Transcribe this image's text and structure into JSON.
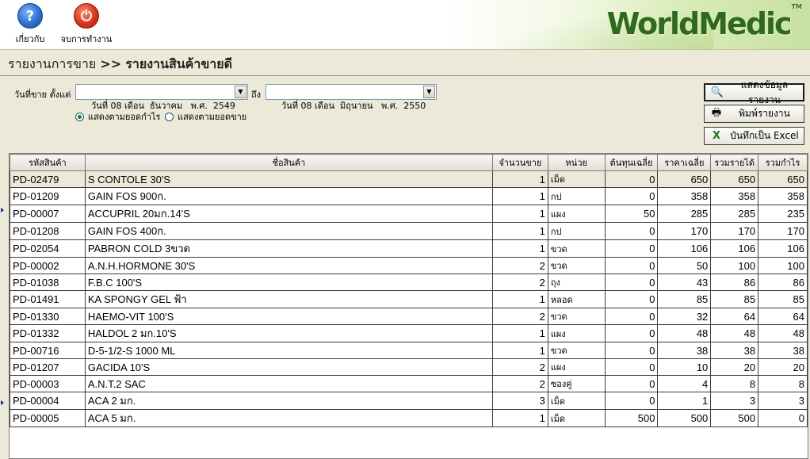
{
  "toolbar": {
    "about_label": "เกี่ยวกับ",
    "exit_label": "จบการทำงาน",
    "logo_text": "WorldMedic",
    "logo_tm": "TM"
  },
  "breadcrumb": {
    "section": "รายงานการขาย",
    "separator": ">>",
    "page": "รายงานสินค้าขายดี"
  },
  "filter": {
    "date_label": "วันที่ขาย  ตั้งแต่",
    "from_date": "วันที่ 08 เดือน  ธันวาคม   พ.ศ.  2549",
    "to_label": "ถึง",
    "to_date": "วันที่ 08 เดือน  มิถุนายน   พ.ศ.  2550",
    "radio_profit": "แสดงตามยอดกำไร",
    "radio_sales": "แสดงตามยอดขาย",
    "selected": "profit"
  },
  "buttons": {
    "show_report": "แสดงข้อมูลรายงาน",
    "print_report": "พิมพ์รายงาน",
    "save_excel": "บันทึกเป็น Excel"
  },
  "table": {
    "headers": [
      "รหัสสินค้า",
      "ชื่อสินค้า",
      "จำนวนขาย",
      "หน่วย",
      "ต้นทุนเฉลี่ย",
      "ราคาเฉลี่ย",
      "รวมรายได้",
      "รวมกำไร"
    ],
    "rows": [
      [
        "PD-02479",
        "S CONTOLE 30'S",
        "1",
        "เม็ด",
        "0",
        "650",
        "650",
        "650"
      ],
      [
        "PD-01209",
        "GAIN FOS 900ก.",
        "1",
        "กป",
        "0",
        "358",
        "358",
        "358"
      ],
      [
        "PD-00007",
        "ACCUPRIL 20มก.14'S",
        "1",
        "แผง",
        "50",
        "285",
        "285",
        "235"
      ],
      [
        "PD-01208",
        "GAIN FOS 400ก.",
        "1",
        "กป",
        "0",
        "170",
        "170",
        "170"
      ],
      [
        "PD-02054",
        "PABRON COLD 3ขวด",
        "1",
        "ขวด",
        "0",
        "106",
        "106",
        "106"
      ],
      [
        "PD-00002",
        "A.N.H.HORMONE 30'S",
        "2",
        "ขวด",
        "0",
        "50",
        "100",
        "100"
      ],
      [
        "PD-01038",
        "F.B.C 100'S",
        "2",
        "ถุง",
        "0",
        "43",
        "86",
        "86"
      ],
      [
        "PD-01491",
        "KA SPONGY GEL ฟ้า",
        "1",
        "หลอด",
        "0",
        "85",
        "85",
        "85"
      ],
      [
        "PD-01330",
        "HAEMO-VIT 100'S",
        "2",
        "ขวด",
        "0",
        "32",
        "64",
        "64"
      ],
      [
        "PD-01332",
        "HALDOL 2 มก.10'S",
        "1",
        "แผง",
        "0",
        "48",
        "48",
        "48"
      ],
      [
        "PD-00716",
        "D-5-1/2-S 1000 ML",
        "1",
        "ขวด",
        "0",
        "38",
        "38",
        "38"
      ],
      [
        "PD-01207",
        "GACIDA 10'S",
        "2",
        "แผง",
        "0",
        "10",
        "20",
        "20"
      ],
      [
        "PD-00003",
        "A.N.T.2 SAC",
        "2",
        "ซองคู่",
        "0",
        "4",
        "8",
        "8"
      ],
      [
        "PD-00004",
        "ACA 2 มก.",
        "3",
        "เม็ด",
        "0",
        "1",
        "3",
        "3"
      ],
      [
        "PD-00005",
        "ACA 5 มก.",
        "1",
        "เม็ด",
        "500",
        "500",
        "500",
        "0"
      ]
    ]
  }
}
